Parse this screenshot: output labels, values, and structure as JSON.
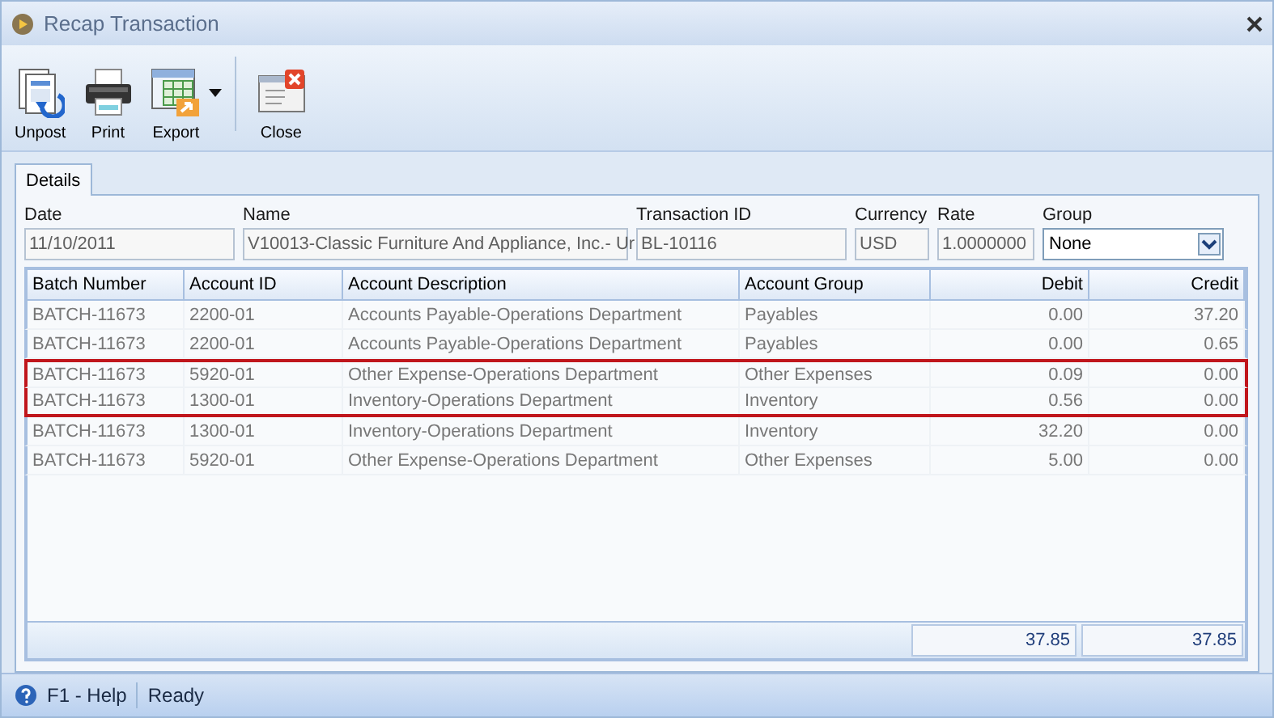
{
  "window": {
    "title": "Recap Transaction"
  },
  "toolbar": [
    {
      "label": "Unpost",
      "kind": "unpost",
      "dropdown": false
    },
    {
      "label": "Print",
      "kind": "print",
      "dropdown": false
    },
    {
      "label": "Export",
      "kind": "export",
      "dropdown": true
    },
    {
      "label": "Close",
      "kind": "close",
      "dropdown": false
    }
  ],
  "tabs": [
    {
      "label": "Details",
      "selected": true
    }
  ],
  "fields": [
    {
      "label": "Date",
      "value": "11/10/2011",
      "kind": "text"
    },
    {
      "label": "Name",
      "value": "V10013-Classic Furniture And Appliance, Inc.- Ur",
      "kind": "text"
    },
    {
      "label": "Transaction ID",
      "value": "BL-10116",
      "kind": "text"
    },
    {
      "label": "Currency",
      "value": "USD",
      "kind": "text"
    },
    {
      "label": "Rate",
      "value": "1.0000000",
      "kind": "text"
    },
    {
      "label": "Group",
      "value": "None",
      "kind": "select"
    }
  ],
  "table": {
    "columns": [
      "Batch Number",
      "Account ID",
      "Account Description",
      "Account Group",
      "Debit",
      "Credit"
    ],
    "rows": [
      {
        "cells": [
          "BATCH-11673",
          "2200-01",
          "Accounts Payable-Operations Department",
          "Payables",
          "0.00",
          "37.20"
        ],
        "highlighted": false
      },
      {
        "cells": [
          "BATCH-11673",
          "2200-01",
          "Accounts Payable-Operations Department",
          "Payables",
          "0.00",
          "0.65"
        ],
        "highlighted": false
      },
      {
        "cells": [
          "BATCH-11673",
          "5920-01",
          "Other Expense-Operations Department",
          "Other Expenses",
          "0.09",
          "0.00"
        ],
        "highlighted": true
      },
      {
        "cells": [
          "BATCH-11673",
          "1300-01",
          "Inventory-Operations Department",
          "Inventory",
          "0.56",
          "0.00"
        ],
        "highlighted": true
      },
      {
        "cells": [
          "BATCH-11673",
          "1300-01",
          "Inventory-Operations Department",
          "Inventory",
          "32.20",
          "0.00"
        ],
        "highlighted": false
      },
      {
        "cells": [
          "BATCH-11673",
          "5920-01",
          "Other Expense-Operations Department",
          "Other Expenses",
          "5.00",
          "0.00"
        ],
        "highlighted": false
      }
    ],
    "totals": [
      "37.85",
      "37.85"
    ]
  },
  "status_bar": {
    "help": "F1 - Help",
    "status": "Ready"
  }
}
